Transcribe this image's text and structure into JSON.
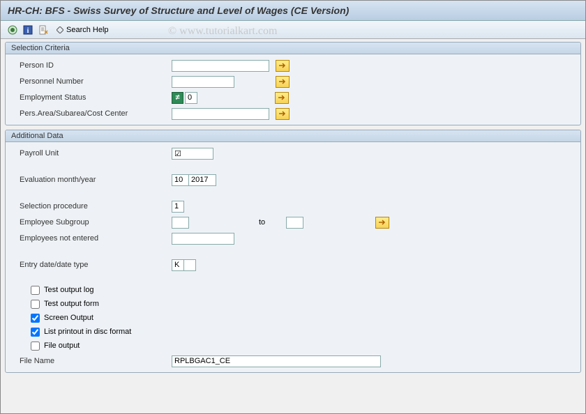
{
  "window": {
    "title": "HR-CH: BFS - Swiss Survey of Structure and Level of Wages (CE Version)"
  },
  "watermark": "© www.tutorialkart.com",
  "toolbar": {
    "search_help": "Search Help"
  },
  "group1": {
    "title": "Selection Criteria",
    "person_id_label": "Person ID",
    "person_id_value": "",
    "personnel_number_label": "Personnel Number",
    "personnel_number_value": "",
    "employment_status_label": "Employment Status",
    "employment_status_value": "0",
    "pers_area_label": "Pers.Area/Subarea/Cost Center",
    "pers_area_value": ""
  },
  "group2": {
    "title": "Additional Data",
    "payroll_unit_label": "Payroll Unit",
    "payroll_unit_value": "☑",
    "eval_month_year_label": "Evaluation month/year",
    "eval_month_value": "10",
    "eval_year_value": "2017",
    "selection_procedure_label": "Selection procedure",
    "selection_procedure_value": "1",
    "employee_subgroup_label": "Employee Subgroup",
    "employee_subgroup_from": "",
    "to_label": "to",
    "employee_subgroup_to": "",
    "employees_not_entered_label": "Employees not entered",
    "employees_not_entered_value": "",
    "entry_date_label": "Entry date/date type",
    "entry_date_value1": "K",
    "entry_date_value2": "",
    "test_output_log_label": "Test output log",
    "test_output_form_label": "Test output form",
    "screen_output_label": "Screen Output",
    "list_printout_label": "List printout in disc format",
    "file_output_label": "File output",
    "file_name_label": "File Name",
    "file_name_value": "RPLBGAC1_CE"
  }
}
